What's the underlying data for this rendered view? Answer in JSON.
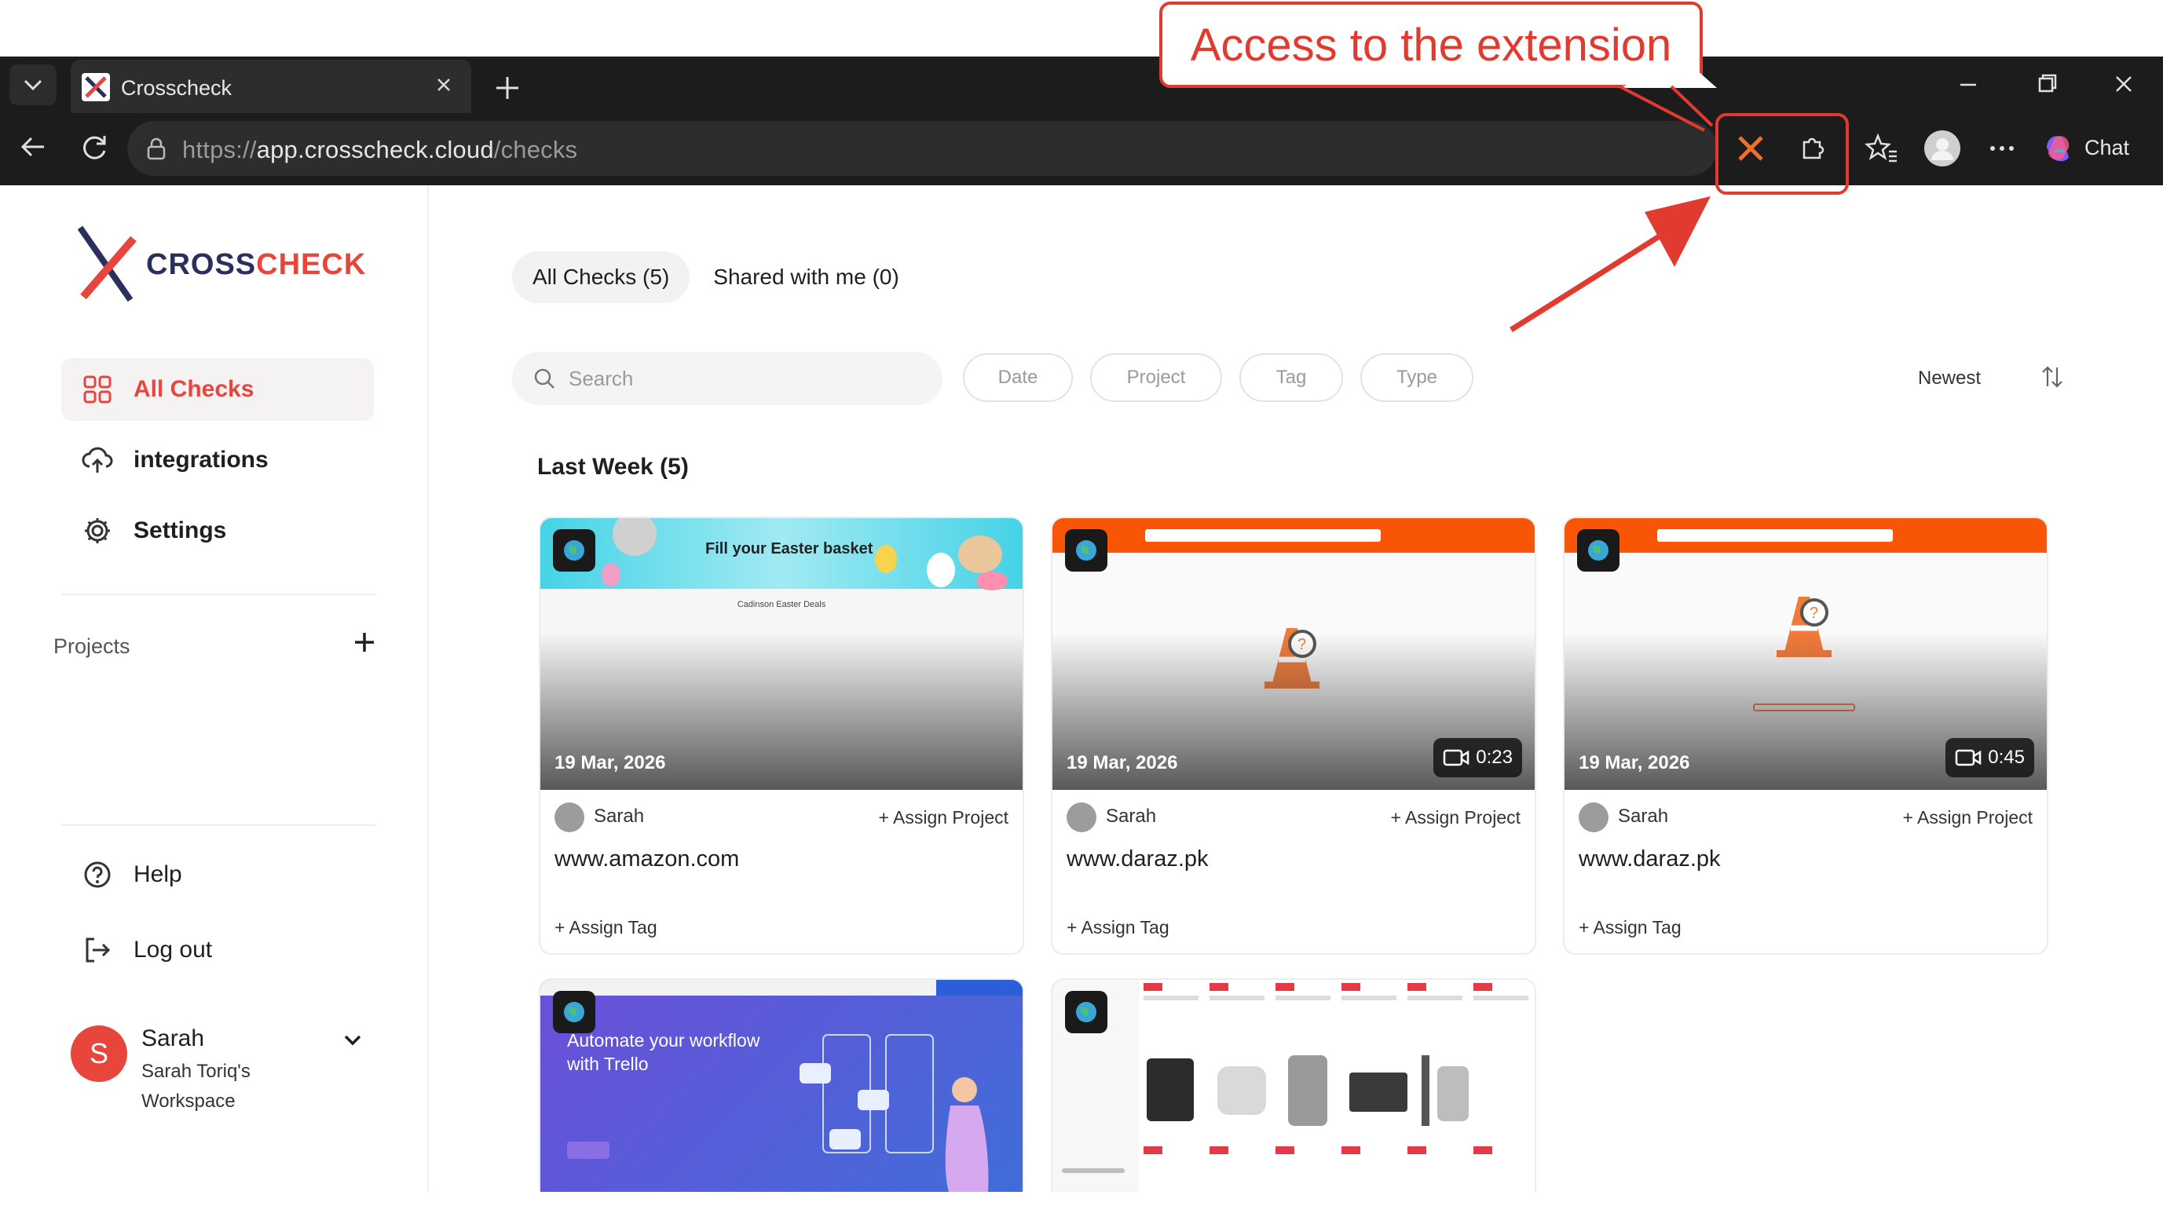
{
  "browser": {
    "tab_title": "Crosscheck",
    "url_scheme": "https://",
    "url_host": "app.crosscheck.cloud",
    "url_path": "/checks",
    "chat_label": "Chat"
  },
  "annotation": {
    "callout_text": "Access to the extension",
    "color": "#e13b30"
  },
  "sidebar": {
    "logo_part1": "CROSS",
    "logo_part2": "CHECK",
    "nav": [
      {
        "label": "All Checks",
        "icon": "grid-icon",
        "active": true
      },
      {
        "label": "integrations",
        "icon": "cloud-upload-icon",
        "active": false
      },
      {
        "label": "Settings",
        "icon": "gear-icon",
        "active": false
      }
    ],
    "projects_label": "Projects",
    "bottom_nav": [
      {
        "label": "Help",
        "icon": "help-icon"
      },
      {
        "label": "Log out",
        "icon": "logout-icon"
      }
    ],
    "user": {
      "initial": "S",
      "name": "Sarah",
      "workspace": "Sarah Toriq's Workspace"
    }
  },
  "main": {
    "tabs": [
      {
        "label": "All Checks (5)",
        "active": true
      },
      {
        "label": "Shared with me (0)",
        "active": false
      }
    ],
    "search_placeholder": "Search",
    "filters": [
      "Date",
      "Project",
      "Tag",
      "Type"
    ],
    "sort_label": "Newest",
    "section_title": "Last Week (5)",
    "cards": [
      {
        "date": "19 Mar, 2026",
        "duration": "",
        "author": "Sarah",
        "assign_project": "+ Assign Project",
        "domain": "www.amazon.com",
        "assign_tag": "+ Assign Tag",
        "thumb_banner": "Fill your Easter basket",
        "thumb_sub": "Cadinson Easter Deals"
      },
      {
        "date": "19 Mar, 2026",
        "duration": "0:23",
        "author": "Sarah",
        "assign_project": "+ Assign Project",
        "domain": "www.daraz.pk",
        "assign_tag": "+ Assign Tag"
      },
      {
        "date": "19 Mar, 2026",
        "duration": "0:45",
        "author": "Sarah",
        "assign_project": "+ Assign Project",
        "domain": "www.daraz.pk",
        "assign_tag": "+ Assign Tag"
      },
      {
        "thumb_title": "Automate your workflow with Trello"
      },
      {}
    ]
  },
  "colors": {
    "accent": "#e8453c",
    "brand_dark": "#2a2f5c",
    "daraz_orange": "#f85606"
  }
}
